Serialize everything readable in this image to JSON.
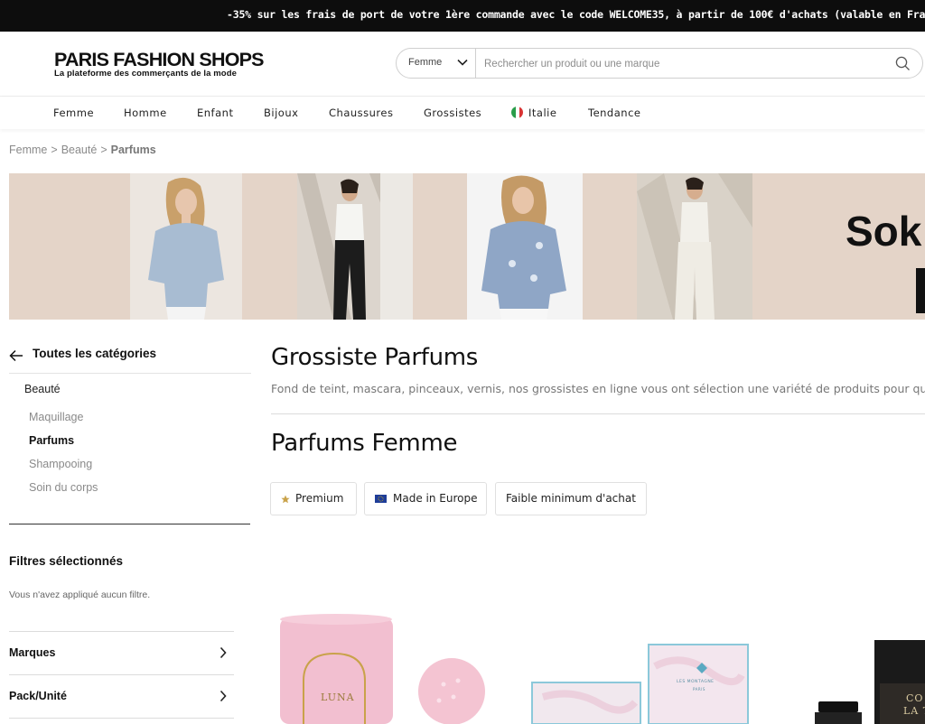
{
  "promo": {
    "text": "-35% sur les frais de port de votre 1ère commande avec le code WELCOME35, à partir de 100€ d'achats (valable en France métropolitaine)"
  },
  "header": {
    "logo_title": "PARIS FASHION SHOPS",
    "logo_subtitle": "La plateforme des commerçants de la mode",
    "search": {
      "category_value": "Femme",
      "placeholder": "Rechercher un produit ou une marque"
    }
  },
  "nav": {
    "items": [
      "Femme",
      "Homme",
      "Enfant",
      "Bijoux",
      "Chaussures",
      "Grossistes",
      "Italie",
      "Tendance"
    ]
  },
  "breadcrumb": {
    "items": [
      "Femme",
      "Beauté"
    ],
    "current": "Parfums",
    "separator": ">"
  },
  "banner": {
    "text": "Sok",
    "background_color": "#e4d4c8"
  },
  "sidebar": {
    "back_label": "Toutes les catégories",
    "parent_category": "Beauté",
    "categories": [
      {
        "label": "Maquillage",
        "active": false
      },
      {
        "label": "Parfums",
        "active": true
      },
      {
        "label": "Shampooing",
        "active": false
      },
      {
        "label": "Soin du corps",
        "active": false
      }
    ],
    "filters_title": "Filtres sélectionnés",
    "filters_empty": "Vous n'avez appliqué aucun filtre.",
    "filter_sections": [
      "Marques",
      "Pack/Unité"
    ]
  },
  "main": {
    "title": "Grossiste Parfums",
    "description": "Fond de teint, mascara, pinceaux, vernis, nos grossistes en ligne vous ont sélection une variété de produits pour que vous",
    "subtitle": "Parfums Femme",
    "chips": [
      "Premium",
      "Made in Europe",
      "Faible minimum d'achat"
    ]
  },
  "products": {
    "luna_label": "LUNA",
    "box_brand": "LES MONTAGNE",
    "box_sub": "PARIS",
    "black_label_1": "CO",
    "black_label_2": "LA T"
  },
  "colors": {
    "promo_bg": "#0d0d0d",
    "star": "#c9a24a",
    "eu_flag": "#1f3d99",
    "italy_green": "#2a9d4a",
    "italy_red": "#d93434"
  }
}
